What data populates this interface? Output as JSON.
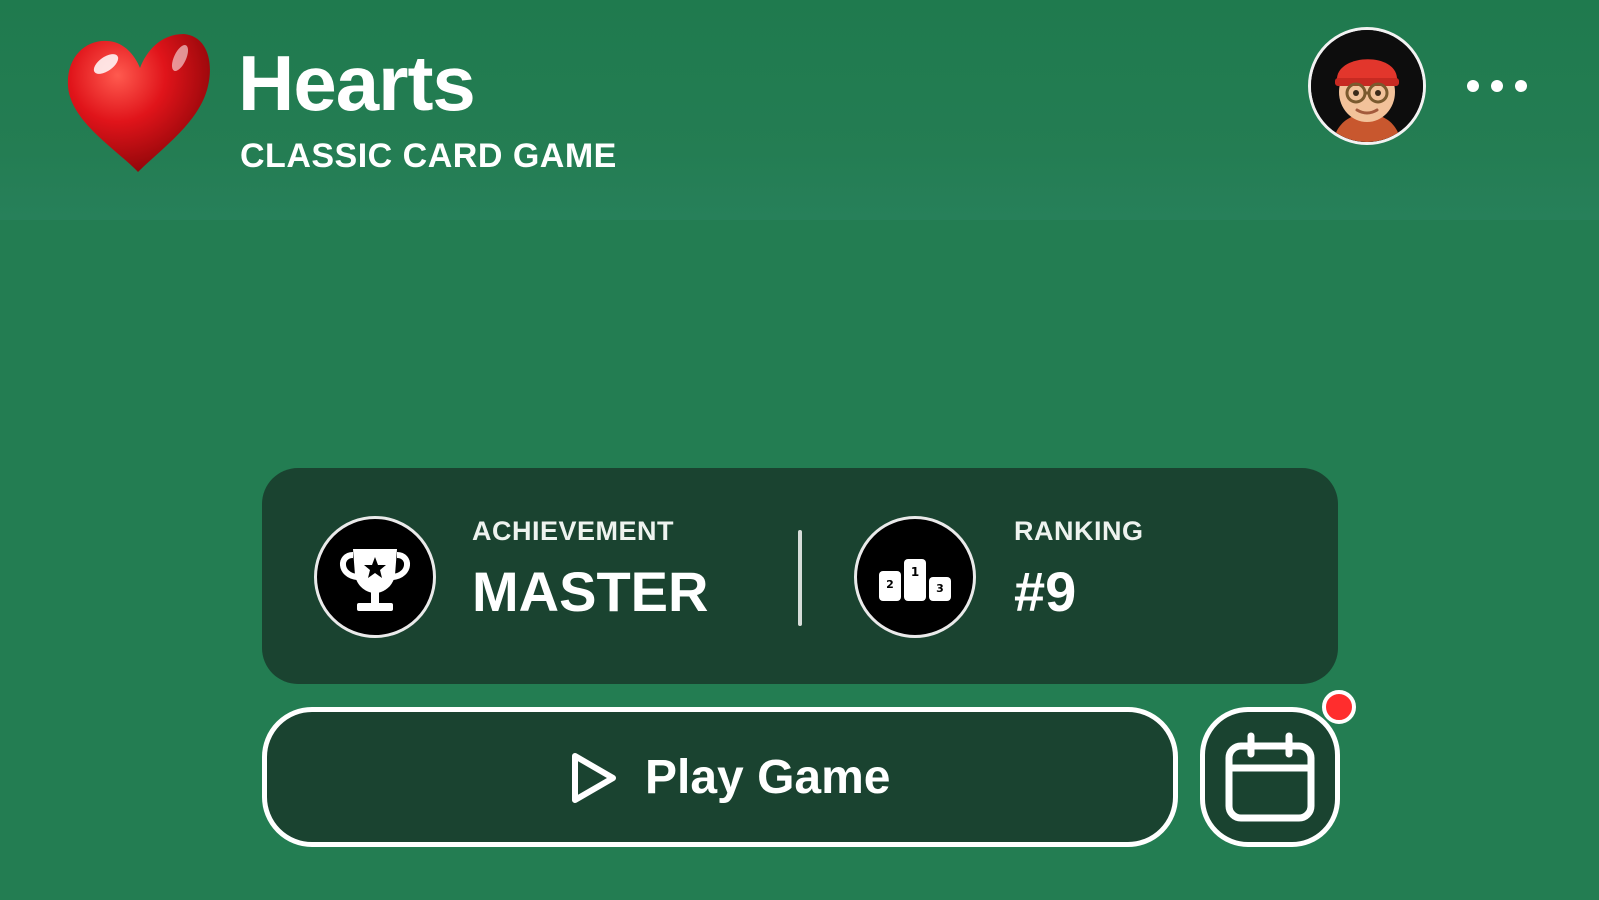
{
  "header": {
    "title": "Hearts",
    "subtitle": "CLASSIC CARD GAME",
    "logo_icon": "heart-icon",
    "avatar_icon": "memoji-avatar",
    "more_icon": "ellipsis-icon"
  },
  "stats": {
    "achievement": {
      "label": "ACHIEVEMENT",
      "value": "MASTER",
      "icon": "trophy-icon"
    },
    "ranking": {
      "label": "RANKING",
      "value": "#9",
      "icon": "podium-icon"
    }
  },
  "actions": {
    "play_label": "Play Game",
    "play_icon": "play-icon",
    "calendar_icon": "calendar-icon",
    "calendar_has_notification": true
  },
  "colors": {
    "background": "#237d52",
    "card": "#1a4330",
    "notification": "#ff2d2d",
    "heart": "#d40d12"
  }
}
